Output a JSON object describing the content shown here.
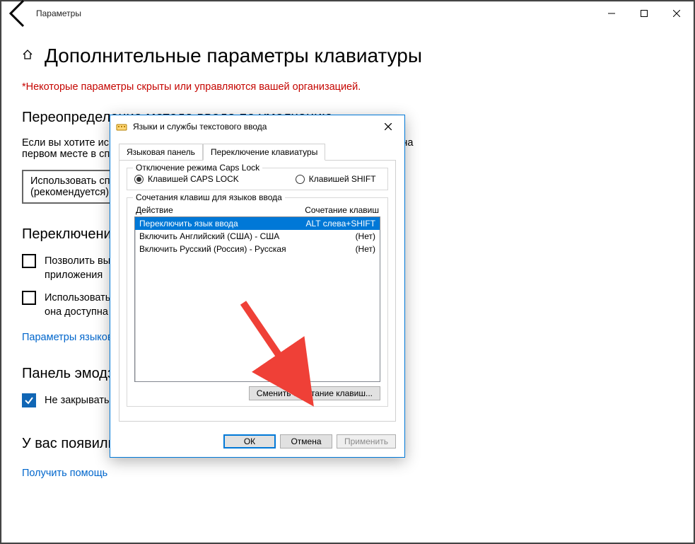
{
  "window": {
    "title": "Параметры",
    "page_title": "Дополнительные параметры клавиатуры",
    "warning": "*Некоторые параметры скрыты или управляются вашей организацией."
  },
  "sections": {
    "override": {
      "heading": "Переопределение метода ввода по умолчанию",
      "body": "Если вы хотите использовать метод ввода, отличный от того, который стоит не на первом месте в списке языков, выберите нужный метод ввода здесь.",
      "dropdown_value": "Использовать список языков (рекомендуется)"
    },
    "switching": {
      "heading": "Переключение методов ввода",
      "chk1": "Позволить выбирать метод ввода для каждого приложения",
      "chk2": "Использовать языковую панель на рабочем столе, если она доступна",
      "link": "Параметры языковой панели"
    },
    "emoji": {
      "heading": "Панель эмодзи",
      "chk": "Не закрывать панель автоматически после ввода эмодзи"
    },
    "help": {
      "heading": "У вас появились вопросы?",
      "link": "Получить помощь"
    }
  },
  "dialog": {
    "title": "Языки и службы текстового ввода",
    "tabs": {
      "panel": "Языковая панель",
      "switch": "Переключение клавиатуры"
    },
    "capslock": {
      "legend": "Отключение режима Caps Lock",
      "opt_caps": "Клавишей CAPS LOCK",
      "opt_shift": "Клавишей SHIFT"
    },
    "hotkeys": {
      "legend": "Сочетания клавиш для языков ввода",
      "col_action": "Действие",
      "col_keys": "Сочетание клавиш",
      "rows": [
        {
          "action": "Переключить язык ввода",
          "keys": "ALT слева+SHIFT"
        },
        {
          "action": "Включить Английский (США) - США",
          "keys": "(Нет)"
        },
        {
          "action": "Включить Русский (Россия) - Русская",
          "keys": "(Нет)"
        }
      ],
      "change_btn": "Сменить сочетание клавиш..."
    },
    "buttons": {
      "ok": "ОК",
      "cancel": "Отмена",
      "apply": "Применить"
    }
  }
}
